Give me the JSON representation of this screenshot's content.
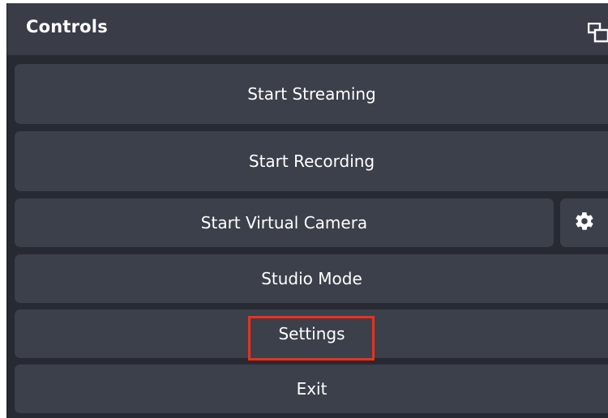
{
  "dock": {
    "title": "Controls",
    "undock_icon": "undock-icon"
  },
  "controls": {
    "start_streaming": "Start Streaming",
    "start_recording": "Start Recording",
    "start_virtual_camera": "Start Virtual Camera",
    "virtual_camera_settings_icon": "gear-icon",
    "studio_mode": "Studio Mode",
    "settings": "Settings",
    "exit": "Exit"
  },
  "colors": {
    "panel_bg": "#272a33",
    "header_bg": "#3a3d48",
    "button_bg": "#3c404b",
    "text": "#ffffff",
    "highlight": "#e8321e"
  }
}
